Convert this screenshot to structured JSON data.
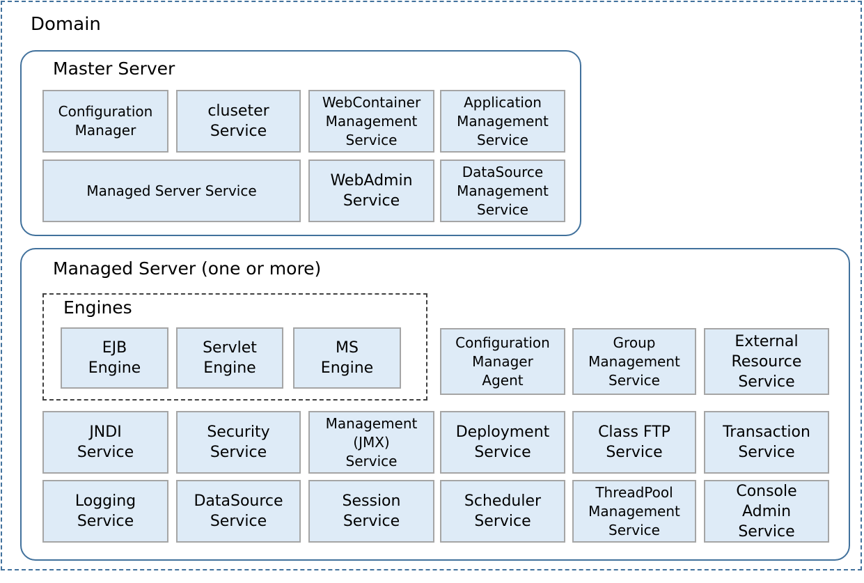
{
  "domain": {
    "title": "Domain"
  },
  "master_server": {
    "title": "Master Server",
    "services": [
      "Configuration\nManager",
      "cluseter\nService",
      "WebContainer\nManagement\nService",
      "Application\nManagement\nService",
      "Managed Server Service",
      "WebAdmin\nService",
      "DataSource\nManagement\nService"
    ]
  },
  "managed_server": {
    "title": "Managed Server (one or more)",
    "engines": {
      "title": "Engines",
      "items": [
        "EJB\nEngine",
        "Servlet\nEngine",
        "MS\nEngine"
      ]
    },
    "services": [
      "Configuration\nManager\nAgent",
      "Group\nManagement\nService",
      "External\nResource\nService",
      "JNDI\nService",
      "Security\nService",
      "Management\n(JMX)\nService",
      "Deployment\nService",
      "Class FTP\nService",
      "Transaction\nService",
      "Logging\nService",
      "DataSource\nService",
      "Session\nService",
      "Scheduler\nService",
      "ThreadPool\nManagement\nService",
      "Console\nAdmin\nService"
    ]
  }
}
